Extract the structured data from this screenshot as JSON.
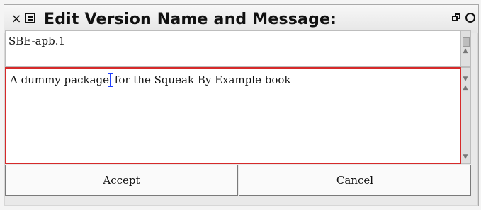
{
  "window": {
    "title": "Edit Version Name and Message:",
    "close_glyph": "×",
    "icons": [
      "close-icon",
      "window-menu-icon",
      "collapse-icon",
      "expand-icon"
    ]
  },
  "version_name": {
    "value": "SBE-apb.1"
  },
  "message": {
    "before_cursor": "A dummy package",
    "after_cursor": " for the Squeak By Example book"
  },
  "buttons": {
    "accept_label": "Accept",
    "cancel_label": "Cancel"
  },
  "colors": {
    "focus_border": "#d62a2a",
    "cursor": "#1f3fff"
  }
}
